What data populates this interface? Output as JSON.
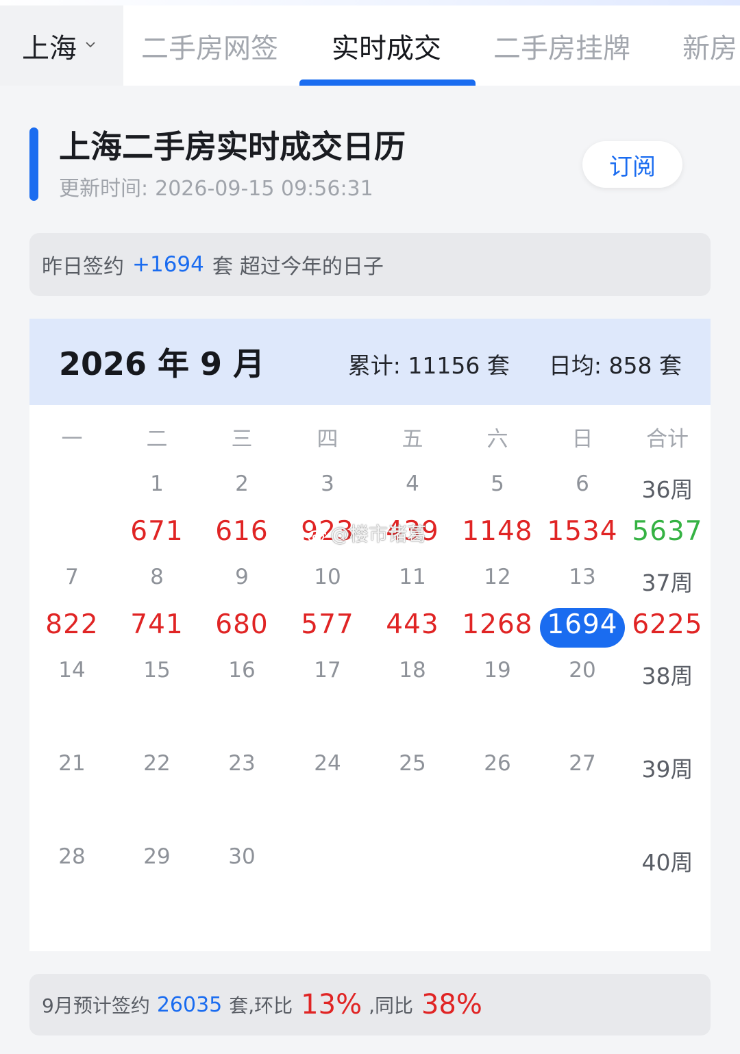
{
  "topbar": {
    "city": "上海",
    "tabs": [
      {
        "label": "二手房网签",
        "active": false
      },
      {
        "label": "实时成交",
        "active": true
      },
      {
        "label": "二手房挂牌",
        "active": false
      },
      {
        "label": "新房",
        "active": false
      }
    ]
  },
  "header": {
    "title": "上海二手房实时成交日历",
    "update_label": "更新时间:",
    "update_time": "2026-09-15 09:56:31",
    "subscribe_label": "订阅"
  },
  "yesterday": {
    "prefix": "昨日签约",
    "value": "+1694",
    "unit": "套",
    "suffix": "超过今年的日子"
  },
  "calendar": {
    "month_label": "2026 年 9 月",
    "cumulative_label": "累计:",
    "cumulative_value": "11156 套",
    "daily_avg_label": "日均:",
    "daily_avg_value": "858 套",
    "weekday_headers": [
      "一",
      "二",
      "三",
      "四",
      "五",
      "六",
      "日",
      "合计"
    ],
    "weeks": [
      {
        "days": [
          "",
          "1",
          "2",
          "3",
          "4",
          "5",
          "6"
        ],
        "week_label": "36周",
        "values": [
          "",
          "671",
          "616",
          "923",
          "439",
          "1148",
          "1534"
        ],
        "total": "5637"
      },
      {
        "days": [
          "7",
          "8",
          "9",
          "10",
          "11",
          "12",
          "13"
        ],
        "week_label": "37周",
        "values": [
          "822",
          "741",
          "680",
          "577",
          "443",
          "1268",
          "1694"
        ],
        "total": "6225"
      },
      {
        "days": [
          "14",
          "15",
          "16",
          "17",
          "18",
          "19",
          "20"
        ],
        "week_label": "38周",
        "values": [
          "",
          "",
          "",
          "",
          "",
          "",
          ""
        ],
        "total": ""
      },
      {
        "days": [
          "21",
          "22",
          "23",
          "24",
          "25",
          "26",
          "27"
        ],
        "week_label": "39周",
        "values": [
          "",
          "",
          "",
          "",
          "",
          "",
          ""
        ],
        "total": ""
      },
      {
        "days": [
          "28",
          "29",
          "30",
          "",
          "",
          "",
          ""
        ],
        "week_label": "40周",
        "values": [
          "",
          "",
          "",
          "",
          "",
          "",
          ""
        ],
        "total": ""
      }
    ],
    "selected": {
      "week": 1,
      "col": 6
    },
    "colors": {
      "value": "#e02424",
      "total": "#35b243",
      "selected": "#1a6cf0"
    }
  },
  "watermark": "@楼市诸葛",
  "forecast": {
    "prefix": "9月预计签约",
    "value": "26035",
    "unit_mom": "套,环比",
    "mom": "13%",
    "sep_yoy": ",同比",
    "yoy": "38%"
  },
  "colors": {
    "accent": "#1a6cf0",
    "red": "#e02424",
    "green": "#35b243"
  }
}
